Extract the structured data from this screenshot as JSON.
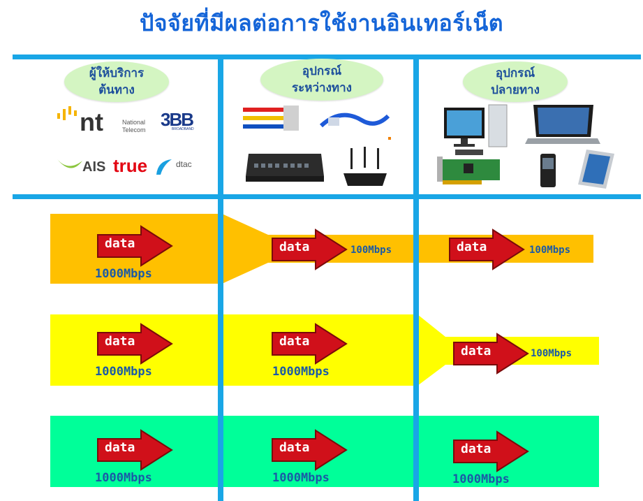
{
  "title": "ปัจจัยที่มีผลต่อการใช้งานอินเทอร์เน็ต",
  "columns": [
    {
      "line1": "ผู้ให้บริการ",
      "line2": "ต้นทาง"
    },
    {
      "line1": "อุปกรณ์",
      "line2": "ระหว่างทาง"
    },
    {
      "line1": "อุปกรณ์",
      "line2": "ปลายทาง"
    }
  ],
  "logos": {
    "nt": "nt",
    "nt_name1": "National",
    "nt_name2": "Telecom",
    "bb3": "3BB",
    "bb3_sub": "BROADBAND",
    "ais": "AIS",
    "true": "true",
    "dtac": "dtac"
  },
  "arrow_label": "data",
  "rows": [
    {
      "color": "#ffc000",
      "speeds": [
        "1000Mbps",
        "100Mbps",
        "100Mbps"
      ]
    },
    {
      "color": "#ffff00",
      "speeds": [
        "1000Mbps",
        "1000Mbps",
        "100Mbps"
      ]
    },
    {
      "color": "#00ff99",
      "speeds": [
        "1000Mbps",
        "1000Mbps",
        "1000Mbps"
      ]
    }
  ],
  "colors": {
    "accent_blue": "#19a6e6",
    "title_blue": "#1565d8",
    "arrow_red": "#d0101a"
  }
}
